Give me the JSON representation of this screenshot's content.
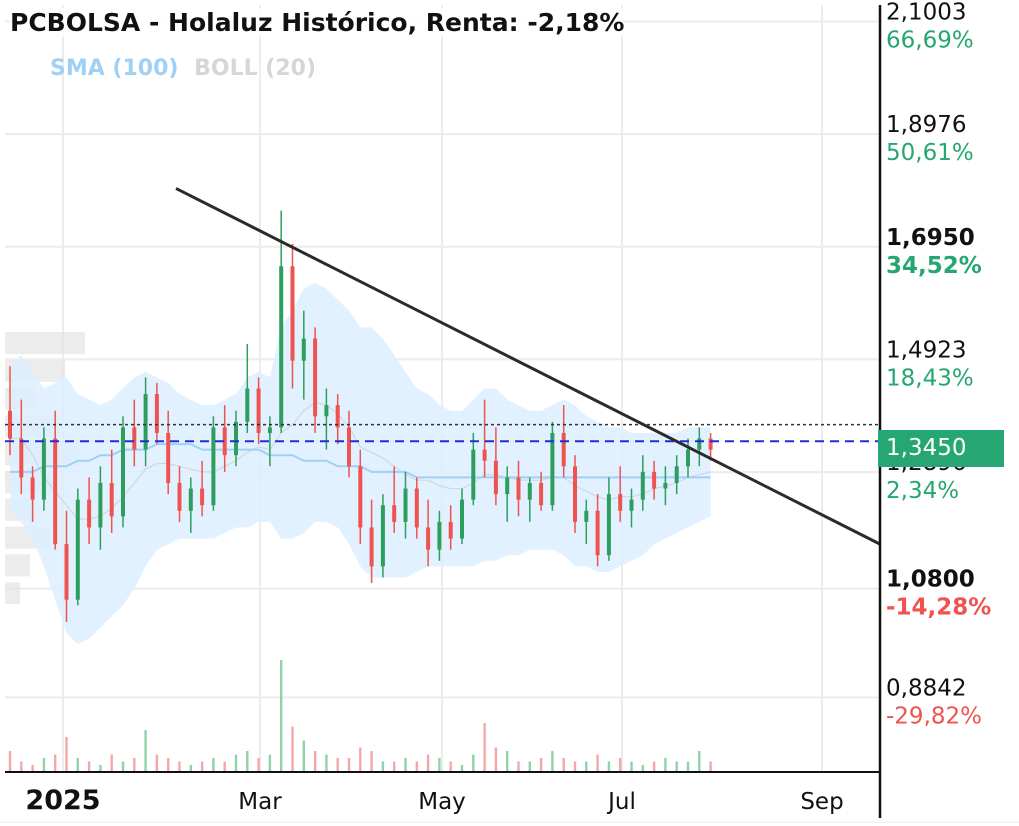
{
  "title": "PCBOLSA - Holaluz Histórico, Renta: -2,18%",
  "legend": [
    {
      "label": "SMA (100)",
      "color": "#9fd0f5"
    },
    {
      "label": "BOLL (20)",
      "color": "#d6d6d6"
    }
  ],
  "colors": {
    "up": "#2e9e5e",
    "down": "#ef5350",
    "pos_text": "#26a672",
    "neg_text": "#ef5350",
    "band_fill": "#dcefff",
    "sma": "#9fd0f5",
    "trendline": "#2b2b2b",
    "current_line": "#1f2dd8"
  },
  "current_price_label": "1,3450",
  "chart_data": {
    "type": "candlestick",
    "title": "PCBOLSA - Holaluz Histórico, Renta: -2,18%",
    "x_labels": [
      "2025",
      "Mar",
      "May",
      "Jul",
      "Sep"
    ],
    "price_axis": [
      {
        "price": "2,1003",
        "pct": "66,69%",
        "sign": "pos",
        "bold": false
      },
      {
        "price": "1,8976",
        "pct": "50,61%",
        "sign": "pos",
        "bold": false
      },
      {
        "price": "1,6950",
        "pct": "34,52%",
        "sign": "pos",
        "bold": true
      },
      {
        "price": "1,4923",
        "pct": "18,43%",
        "sign": "pos",
        "bold": false
      },
      {
        "price": "1,2896",
        "pct": "2,34%",
        "sign": "pos",
        "bold": false
      },
      {
        "price": "1,0800",
        "pct": "-14,28%",
        "sign": "neg",
        "bold": true
      },
      {
        "price": "0,8842",
        "pct": "-29,82%",
        "sign": "neg",
        "bold": false
      }
    ],
    "ylim": [
      0.75,
      2.13
    ],
    "current_price": 1.345,
    "reference_price": 1.375,
    "series_ohlc": [
      [
        1.4,
        1.48,
        1.32,
        1.35
      ],
      [
        1.35,
        1.42,
        1.25,
        1.28
      ],
      [
        1.28,
        1.3,
        1.2,
        1.24
      ],
      [
        1.24,
        1.37,
        1.22,
        1.35
      ],
      [
        1.35,
        1.4,
        1.15,
        1.16
      ],
      [
        1.16,
        1.22,
        1.02,
        1.06
      ],
      [
        1.06,
        1.26,
        1.05,
        1.24
      ],
      [
        1.24,
        1.28,
        1.16,
        1.19
      ],
      [
        1.19,
        1.3,
        1.15,
        1.27
      ],
      [
        1.27,
        1.33,
        1.18,
        1.21
      ],
      [
        1.21,
        1.39,
        1.19,
        1.37
      ],
      [
        1.37,
        1.42,
        1.3,
        1.33
      ],
      [
        1.33,
        1.46,
        1.3,
        1.43
      ],
      [
        1.43,
        1.45,
        1.34,
        1.36
      ],
      [
        1.36,
        1.4,
        1.25,
        1.27
      ],
      [
        1.27,
        1.3,
        1.2,
        1.22
      ],
      [
        1.22,
        1.28,
        1.18,
        1.26
      ],
      [
        1.26,
        1.31,
        1.21,
        1.23
      ],
      [
        1.23,
        1.39,
        1.22,
        1.37
      ],
      [
        1.37,
        1.41,
        1.29,
        1.32
      ],
      [
        1.32,
        1.4,
        1.3,
        1.38
      ],
      [
        1.38,
        1.52,
        1.36,
        1.44
      ],
      [
        1.44,
        1.46,
        1.34,
        1.36
      ],
      [
        1.36,
        1.39,
        1.3,
        1.37
      ],
      [
        1.37,
        1.76,
        1.36,
        1.66
      ],
      [
        1.66,
        1.7,
        1.44,
        1.49
      ],
      [
        1.49,
        1.58,
        1.42,
        1.53
      ],
      [
        1.53,
        1.55,
        1.36,
        1.39
      ],
      [
        1.39,
        1.44,
        1.33,
        1.41
      ],
      [
        1.41,
        1.43,
        1.34,
        1.37
      ],
      [
        1.37,
        1.4,
        1.28,
        1.3
      ],
      [
        1.3,
        1.33,
        1.16,
        1.19
      ],
      [
        1.19,
        1.24,
        1.09,
        1.12
      ],
      [
        1.12,
        1.25,
        1.1,
        1.23
      ],
      [
        1.23,
        1.3,
        1.18,
        1.2
      ],
      [
        1.2,
        1.29,
        1.17,
        1.26
      ],
      [
        1.26,
        1.28,
        1.17,
        1.19
      ],
      [
        1.19,
        1.24,
        1.12,
        1.15
      ],
      [
        1.15,
        1.22,
        1.13,
        1.2
      ],
      [
        1.2,
        1.23,
        1.15,
        1.17
      ],
      [
        1.17,
        1.26,
        1.16,
        1.24
      ],
      [
        1.24,
        1.36,
        1.23,
        1.33
      ],
      [
        1.33,
        1.42,
        1.28,
        1.31
      ],
      [
        1.31,
        1.37,
        1.23,
        1.25
      ],
      [
        1.25,
        1.3,
        1.2,
        1.28
      ],
      [
        1.28,
        1.31,
        1.21,
        1.24
      ],
      [
        1.24,
        1.28,
        1.2,
        1.27
      ],
      [
        1.27,
        1.29,
        1.22,
        1.23
      ],
      [
        1.23,
        1.38,
        1.22,
        1.36
      ],
      [
        1.36,
        1.41,
        1.28,
        1.3
      ],
      [
        1.3,
        1.32,
        1.18,
        1.2
      ],
      [
        1.2,
        1.24,
        1.16,
        1.22
      ],
      [
        1.22,
        1.25,
        1.12,
        1.14
      ],
      [
        1.14,
        1.28,
        1.13,
        1.25
      ],
      [
        1.25,
        1.3,
        1.2,
        1.22
      ],
      [
        1.22,
        1.26,
        1.19,
        1.24
      ],
      [
        1.24,
        1.32,
        1.22,
        1.29
      ],
      [
        1.29,
        1.31,
        1.24,
        1.26
      ],
      [
        1.26,
        1.3,
        1.23,
        1.27
      ],
      [
        1.27,
        1.32,
        1.25,
        1.3
      ],
      [
        1.3,
        1.35,
        1.28,
        1.33
      ],
      [
        1.33,
        1.37,
        1.3,
        1.35
      ],
      [
        1.35,
        1.36,
        1.31,
        1.33
      ]
    ],
    "sma_100": [
      1.29,
      1.29,
      1.29,
      1.3,
      1.3,
      1.3,
      1.31,
      1.31,
      1.32,
      1.32,
      1.33,
      1.33,
      1.33,
      1.34,
      1.34,
      1.34,
      1.34,
      1.33,
      1.33,
      1.33,
      1.33,
      1.33,
      1.33,
      1.32,
      1.32,
      1.32,
      1.31,
      1.31,
      1.31,
      1.3,
      1.3,
      1.3,
      1.29,
      1.29,
      1.29,
      1.29,
      1.28,
      1.28,
      1.28,
      1.28,
      1.28,
      1.28,
      1.28,
      1.28,
      1.28,
      1.28,
      1.28,
      1.28,
      1.28,
      1.28,
      1.28,
      1.28,
      1.28,
      1.28,
      1.28,
      1.28,
      1.28,
      1.28,
      1.28,
      1.28,
      1.28,
      1.28,
      1.28
    ],
    "boll_upper": [
      1.48,
      1.5,
      1.47,
      1.44,
      1.45,
      1.46,
      1.43,
      1.42,
      1.41,
      1.42,
      1.44,
      1.46,
      1.47,
      1.46,
      1.45,
      1.43,
      1.42,
      1.41,
      1.41,
      1.42,
      1.43,
      1.46,
      1.47,
      1.46,
      1.55,
      1.58,
      1.62,
      1.63,
      1.62,
      1.6,
      1.58,
      1.55,
      1.55,
      1.53,
      1.5,
      1.47,
      1.44,
      1.43,
      1.41,
      1.4,
      1.4,
      1.42,
      1.44,
      1.44,
      1.42,
      1.41,
      1.4,
      1.4,
      1.41,
      1.42,
      1.41,
      1.39,
      1.38,
      1.37,
      1.37,
      1.36,
      1.36,
      1.36,
      1.36,
      1.36,
      1.37,
      1.37,
      1.37
    ],
    "boll_lower": [
      1.22,
      1.2,
      1.17,
      1.12,
      1.06,
      1.0,
      0.98,
      0.99,
      1.01,
      1.03,
      1.05,
      1.08,
      1.12,
      1.15,
      1.16,
      1.17,
      1.17,
      1.17,
      1.17,
      1.18,
      1.19,
      1.19,
      1.2,
      1.2,
      1.17,
      1.17,
      1.18,
      1.2,
      1.2,
      1.19,
      1.16,
      1.12,
      1.1,
      1.1,
      1.1,
      1.1,
      1.11,
      1.12,
      1.12,
      1.12,
      1.12,
      1.12,
      1.13,
      1.13,
      1.14,
      1.14,
      1.15,
      1.15,
      1.15,
      1.14,
      1.12,
      1.12,
      1.11,
      1.11,
      1.12,
      1.13,
      1.14,
      1.16,
      1.17,
      1.18,
      1.19,
      1.2,
      1.21
    ],
    "volume": [
      0.6,
      0.3,
      0.2,
      0.4,
      0.5,
      1.0,
      0.4,
      0.3,
      0.2,
      0.5,
      0.3,
      0.4,
      1.2,
      0.5,
      0.4,
      0.3,
      0.2,
      0.3,
      0.4,
      0.3,
      0.5,
      0.6,
      0.4,
      0.5,
      3.2,
      1.3,
      0.9,
      0.6,
      0.5,
      0.4,
      0.4,
      0.7,
      0.6,
      0.3,
      0.3,
      0.4,
      0.3,
      0.5,
      0.4,
      0.3,
      0.2,
      0.5,
      1.4,
      0.7,
      0.6,
      0.3,
      0.3,
      0.4,
      0.6,
      0.4,
      0.3,
      0.3,
      0.5,
      0.3,
      0.4,
      0.3,
      0.2,
      0.3,
      0.4,
      0.3,
      0.3,
      0.6,
      0.3
    ],
    "trendline": {
      "start": {
        "x": "Feb 2025",
        "y": 1.8
      },
      "end": {
        "x": "Sep 2025",
        "y": 1.16
      }
    },
    "grid": true,
    "legend_position": "top-left"
  }
}
